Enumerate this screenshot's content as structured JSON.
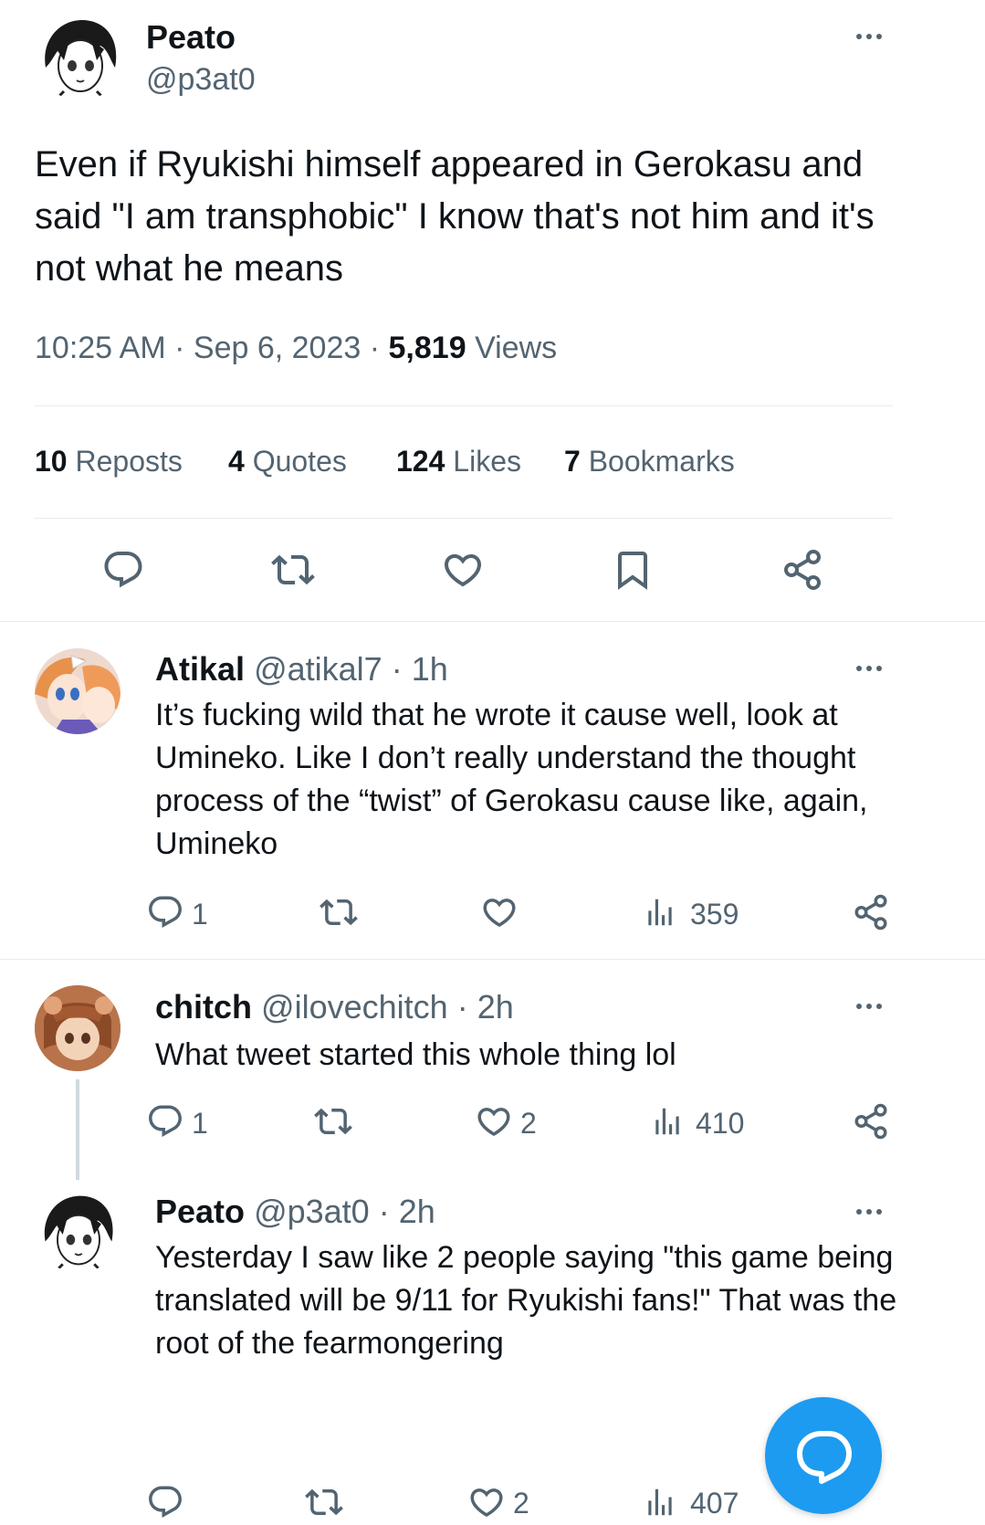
{
  "main": {
    "author_name": "Peato",
    "author_handle": "@p3at0",
    "text": "Even if Ryukishi himself appeared in Gerokasu and said \"I am transphobic\" I know that's not him and it's not what he means",
    "time": "10:25 AM",
    "date": "Sep 6, 2023",
    "views_count": "5,819",
    "views_label": "Views",
    "stats": [
      {
        "count": "10",
        "label": "Reposts"
      },
      {
        "count": "4",
        "label": "Quotes"
      },
      {
        "count": "124",
        "label": "Likes"
      },
      {
        "count": "7",
        "label": "Bookmarks"
      }
    ],
    "actions": [
      "reply-icon",
      "repost-icon",
      "like-icon",
      "bookmark-icon",
      "share-icon"
    ]
  },
  "replies": [
    {
      "name": "Atikal",
      "handle": "@atikal7",
      "time": "1h",
      "text": "It’s fucking wild that he wrote it cause well, look at Umineko. Like I don’t really understand the thought process of the “twist” of Gerokasu cause like, again, Umineko",
      "reply_count": "1",
      "like_count": "",
      "views": "359"
    },
    {
      "name": "chitch",
      "handle": "@ilovechitch",
      "time": "2h",
      "text": "What tweet started this whole thing lol",
      "reply_count": "1",
      "like_count": "2",
      "views": "410"
    },
    {
      "name": "Peato",
      "handle": "@p3at0",
      "time": "2h",
      "text": "Yesterday I saw like 2 people saying \"this game being translated will be 9/11 for Ryukishi fans!\" That was the root of the fearmongering",
      "reply_count": "",
      "like_count": "2",
      "views": "407"
    }
  ],
  "separator": "·",
  "colors": {
    "text": "#0f1419",
    "muted": "#536471",
    "divider": "#e8ecef",
    "accent": "#1d9bf0"
  }
}
